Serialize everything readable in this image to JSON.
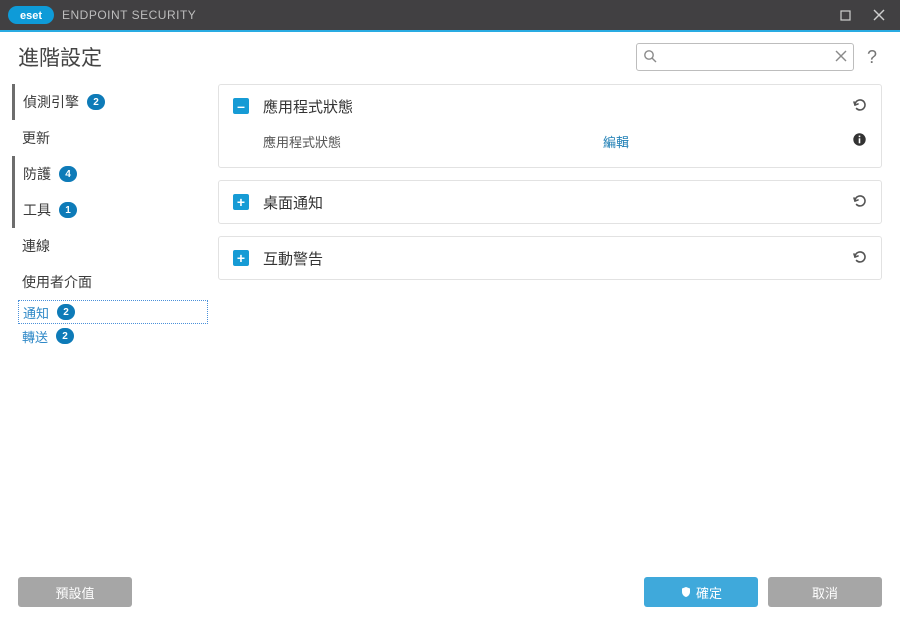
{
  "titlebar": {
    "brand_prefix": "es",
    "brand_suffix": "eт",
    "title": "ENDPOINT SECURITY"
  },
  "header": {
    "page_title": "進階設定",
    "search_placeholder": "",
    "help": "?"
  },
  "sidebar": {
    "items": [
      {
        "label": "偵測引擎",
        "badge": "2",
        "with_bar": true
      },
      {
        "label": "更新",
        "badge": null,
        "with_bar": false
      },
      {
        "label": "防護",
        "badge": "4",
        "with_bar": true
      },
      {
        "label": "工具",
        "badge": "1",
        "with_bar": true
      },
      {
        "label": "連線",
        "badge": null,
        "with_bar": false
      },
      {
        "label": "使用者介面",
        "badge": null,
        "with_bar": false
      }
    ],
    "subnav": [
      {
        "label": "通知",
        "badge": "2",
        "selected": true
      },
      {
        "label": "轉送",
        "badge": "2",
        "selected": false
      }
    ]
  },
  "panels": [
    {
      "expanded": true,
      "toggle": "–",
      "title": "應用程式狀態",
      "undo": "↺",
      "body": {
        "label": "應用程式狀態",
        "action": "編輯",
        "info": "ⓘ"
      }
    },
    {
      "expanded": false,
      "toggle": "+",
      "title": "桌面通知",
      "undo": "↺"
    },
    {
      "expanded": false,
      "toggle": "+",
      "title": "互動警告",
      "undo": "↺"
    }
  ],
  "footer": {
    "defaults": "預設值",
    "ok": "確定",
    "cancel": "取消"
  }
}
